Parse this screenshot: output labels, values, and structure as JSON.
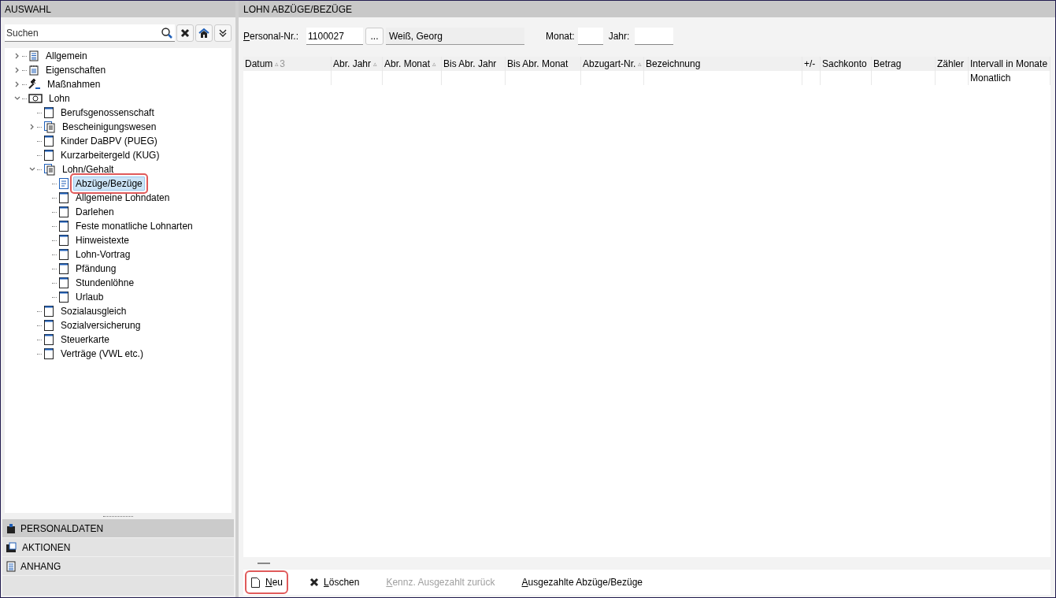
{
  "left_panel": {
    "title": "AUSWAHL",
    "search": {
      "placeholder": "Suchen"
    },
    "tree": [
      {
        "label": "Allgemein",
        "kind": "list",
        "expanded": false,
        "selected": false
      },
      {
        "label": "Eigenschaften",
        "kind": "notepad",
        "expanded": false,
        "selected": false
      },
      {
        "label": "Maßnahmen",
        "kind": "gavel",
        "expanded": false,
        "selected": false
      },
      {
        "label": "Lohn",
        "kind": "money",
        "expanded": true,
        "selected": false,
        "children": [
          {
            "label": "Berufsgenossenschaft",
            "kind": "page",
            "selected": false
          },
          {
            "label": "Bescheinigungswesen",
            "kind": "docs",
            "expanded": false,
            "selected": false
          },
          {
            "label": "Kinder DaBPV (PUEG)",
            "kind": "page",
            "selected": false
          },
          {
            "label": "Kurzarbeitergeld (KUG)",
            "kind": "page",
            "selected": false
          },
          {
            "label": "Lohn/Gehalt",
            "kind": "docs",
            "expanded": true,
            "selected": false,
            "children": [
              {
                "label": "Abzüge/Bezüge",
                "kind": "doclines",
                "selected": true
              },
              {
                "label": "Allgemeine Lohndaten",
                "kind": "page",
                "selected": false
              },
              {
                "label": "Darlehen",
                "kind": "page",
                "selected": false
              },
              {
                "label": "Feste monatliche Lohnarten",
                "kind": "page",
                "selected": false
              },
              {
                "label": "Hinweistexte",
                "kind": "page",
                "selected": false
              },
              {
                "label": "Lohn-Vortrag",
                "kind": "page",
                "selected": false
              },
              {
                "label": "Pfändung",
                "kind": "page",
                "selected": false
              },
              {
                "label": "Stundenlöhne",
                "kind": "page",
                "selected": false
              },
              {
                "label": "Urlaub",
                "kind": "page",
                "selected": false
              }
            ]
          },
          {
            "label": "Sozialausgleich",
            "kind": "page",
            "selected": false
          },
          {
            "label": "Sozialversicherung",
            "kind": "page",
            "selected": false
          },
          {
            "label": "Steuerkarte",
            "kind": "page",
            "selected": false
          },
          {
            "label": "Verträge (VWL etc.)",
            "kind": "page",
            "selected": false
          }
        ]
      }
    ],
    "sections": [
      {
        "label": "PERSONALDATEN",
        "kind": "person",
        "selected": true
      },
      {
        "label": "AKTIONEN",
        "kind": "folder",
        "selected": false
      },
      {
        "label": "ANHANG",
        "kind": "doc",
        "selected": false
      }
    ]
  },
  "main": {
    "title": "LOHN ABZÜGE/BEZÜGE",
    "form": {
      "personal_label": "Personal-Nr.:",
      "personal_value": "1100027",
      "browse": "...",
      "name_value": "Weiß, Georg",
      "month_label": "Monat:",
      "year_label": "Jahr:"
    },
    "table": {
      "columns": [
        {
          "label": "Datum",
          "sort_mark": "▵",
          "sort_index": "3"
        },
        {
          "label": "Abr. Jahr",
          "sort_mark": "▵"
        },
        {
          "label": "Abr. Monat",
          "sort_mark": "▵"
        },
        {
          "label": "Bis Abr. Jahr"
        },
        {
          "label": "Bis Abr. Monat"
        },
        {
          "label": "Abzugart-Nr.",
          "sort_mark": "▵"
        },
        {
          "label": "Bezeichnung"
        },
        {
          "label": "+/-"
        },
        {
          "label": "Sachkonto"
        },
        {
          "label": "Betrag"
        },
        {
          "label": "Zähler"
        },
        {
          "label": "Intervall in Monate"
        }
      ],
      "rows": [
        [
          "",
          "",
          "",
          "",
          "",
          "",
          "",
          "",
          "",
          "",
          "",
          "Monatlich"
        ]
      ]
    },
    "actions": [
      {
        "label": "Neu",
        "kind": "new",
        "disabled": false,
        "highlighted": true
      },
      {
        "label": "Löschen",
        "kind": "delete",
        "disabled": false,
        "highlighted": false
      },
      {
        "label": "Kennz. Ausgezahlt zurück",
        "kind": "plain",
        "disabled": true,
        "highlighted": false
      },
      {
        "label": "Ausgezahlte Abzüge/Bezüge",
        "kind": "plain",
        "disabled": false,
        "highlighted": false
      }
    ]
  }
}
